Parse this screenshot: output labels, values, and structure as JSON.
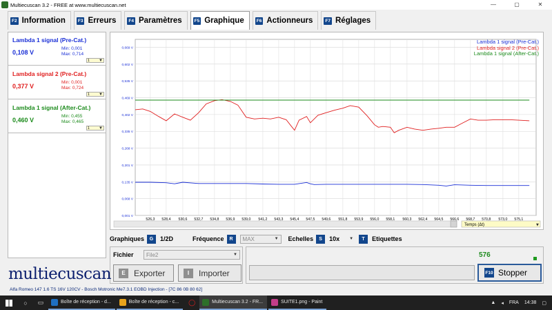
{
  "window": {
    "title": "Multiecuscan 3.2 - FREE at www.multiecuscan.net",
    "controls": [
      "—",
      "▢",
      "✕"
    ]
  },
  "tabs": [
    {
      "key": "F2",
      "label": "Information",
      "active": false
    },
    {
      "key": "F3",
      "label": "Erreurs",
      "active": false
    },
    {
      "key": "F4",
      "label": "Paramètres",
      "active": false
    },
    {
      "key": "F5",
      "label": "Graphique",
      "active": true
    },
    {
      "key": "F6",
      "label": "Actionneurs",
      "active": false
    },
    {
      "key": "F7",
      "label": "Réglages",
      "active": false
    }
  ],
  "signals": [
    {
      "name": "Lambda 1 signal (Pre-Cat.)",
      "value": "0,108 V",
      "min": "Min: 0,001",
      "max": "Max: 0,714",
      "scale": "1",
      "color": "#1a2fd6"
    },
    {
      "name": "Lambda signal 2 (Pre-Cat.)",
      "value": "0,377 V",
      "min": "Min: 0,001",
      "max": "Max: 0,724",
      "scale": "1",
      "color": "#e01e1e"
    },
    {
      "name": "Lambda 1 signal (After-Cat.)",
      "value": "0,460 V",
      "min": "Min: 0,455",
      "max": "Max: 0,465",
      "scale": "1",
      "color": "#1a8a1a"
    }
  ],
  "chart_data": {
    "type": "line",
    "y_ticks": [
      "0,001 V",
      "0,068 V",
      "0,135 V",
      "0,201 V",
      "0,268 V",
      "0,335 V",
      "0,402 V",
      "0,469 V",
      "0,535 V",
      "0,602 V",
      "0,669 V"
    ],
    "x_ticks": [
      "526,3",
      "528,4",
      "530,6",
      "532,7",
      "534,8",
      "536,9",
      "539,0",
      "541,2",
      "543,3",
      "545,4",
      "547,5",
      "549,6",
      "551,8",
      "553,9",
      "556,0",
      "558,1",
      "560,3",
      "562,4",
      "564,5",
      "566,6",
      "568,7",
      "570,8",
      "573,0",
      "575,1"
    ],
    "xlim": [
      524.3,
      577.4
    ],
    "ylim": [
      0.001,
      0.702
    ],
    "time_axis_label": "Temps (Δt)",
    "legend": "top-right",
    "series": [
      {
        "name": "Lambda 1 signal (Pre-Cat.)",
        "color": "#1a2fd6",
        "x": [
          524.3,
          526.3,
          528.4,
          529.5,
          530.6,
          532.7,
          534.8,
          536.9,
          539.0,
          541.2,
          543.3,
          545.4,
          547.0,
          547.5,
          548.0,
          549.6,
          551.8,
          553.9,
          556.0,
          558.1,
          560.3,
          562.4,
          564.5,
          565.5,
          566.6,
          568.7,
          570.8,
          573.0,
          575.1,
          576.5
        ],
        "y": [
          0.133,
          0.133,
          0.131,
          0.127,
          0.133,
          0.128,
          0.128,
          0.128,
          0.128,
          0.126,
          0.125,
          0.125,
          0.132,
          0.127,
          0.124,
          0.125,
          0.125,
          0.125,
          0.125,
          0.125,
          0.125,
          0.124,
          0.121,
          0.118,
          0.123,
          0.121,
          0.12,
          0.12,
          0.12,
          0.12
        ]
      },
      {
        "name": "Lambda signal 2 (Pre-Cat.)",
        "color": "#e01e1e",
        "x": [
          524.3,
          525.3,
          526.3,
          527.4,
          528.4,
          529.5,
          530.6,
          531.6,
          532.7,
          533.7,
          534.8,
          535.8,
          536.9,
          537.9,
          539.0,
          540.1,
          541.2,
          542.2,
          543.3,
          544.3,
          545.0,
          545.4,
          546.0,
          547.0,
          547.5,
          548.5,
          549.6,
          550.7,
          551.8,
          552.8,
          553.9,
          555.0,
          556.0,
          556.5,
          557.1,
          558.1,
          558.6,
          559.2,
          560.3,
          561.3,
          562.4,
          563.5,
          564.5,
          565.5,
          566.6,
          567.6,
          568.7,
          569.7,
          570.8,
          571.9,
          573.0,
          574.0,
          575.1,
          576.5
        ],
        "y": [
          0.422,
          0.425,
          0.415,
          0.395,
          0.378,
          0.405,
          0.392,
          0.38,
          0.41,
          0.445,
          0.458,
          0.462,
          0.455,
          0.44,
          0.392,
          0.385,
          0.388,
          0.385,
          0.392,
          0.382,
          0.355,
          0.34,
          0.38,
          0.395,
          0.37,
          0.4,
          0.41,
          0.42,
          0.428,
          0.438,
          0.432,
          0.398,
          0.362,
          0.352,
          0.355,
          0.352,
          0.33,
          0.34,
          0.352,
          0.345,
          0.34,
          0.345,
          0.348,
          0.352,
          0.352,
          0.368,
          0.385,
          0.38,
          0.38,
          0.382,
          0.382,
          0.382,
          0.38,
          0.378
        ]
      },
      {
        "name": "Lambda 1 signal (After-Cat.)",
        "color": "#1a8a1a",
        "x": [
          524.3,
          576.5
        ],
        "y": [
          0.46,
          0.46
        ]
      }
    ]
  },
  "controls": {
    "graphiques_label": "Graphiques",
    "graphiques_key": "G",
    "graphiques_value": "1/2D",
    "frequence_label": "Fréquence",
    "frequence_key": "R",
    "frequence_value": "MAX",
    "echelles_label": "Echelles",
    "echelles_key": "S",
    "echelles_value": "10x",
    "etiquettes_key": "T",
    "etiquettes_label": "Etiquettes"
  },
  "file": {
    "label": "Fichier",
    "selected": "File2",
    "export_key": "E",
    "export_label": "Exporter",
    "import_key": "I",
    "import_label": "Importer"
  },
  "run": {
    "count": "576",
    "stop_key": "F10",
    "stop_label": "Stopper"
  },
  "logo": "multiecuscan",
  "status": "Alfa Romeo 147 1.6 TS 16V 120CV - Bosch Motronic Me7.3.1 EOBD Injection - [7C 86 0B 80 62]",
  "taskbar": {
    "items": [
      {
        "label": "Boîte de réception - d...",
        "active": false,
        "color": "#1f6fc1"
      },
      {
        "label": "Boîte de réception - c...",
        "active": false,
        "color": "#e8a31c"
      },
      {
        "label": "Multiecuscan 3.2 - FR...",
        "active": true,
        "color": "#2d6f2a"
      },
      {
        "label": "SUITE1.png - Paint",
        "active": false,
        "color": "#c23d8a"
      }
    ],
    "lang": "FRA",
    "time": "14:38"
  },
  "colors": {
    "fkey": "#12468c",
    "pre_cat_1": "#1a2fd6",
    "pre_cat_2": "#e01e1e",
    "after_cat": "#1a8a1a"
  }
}
